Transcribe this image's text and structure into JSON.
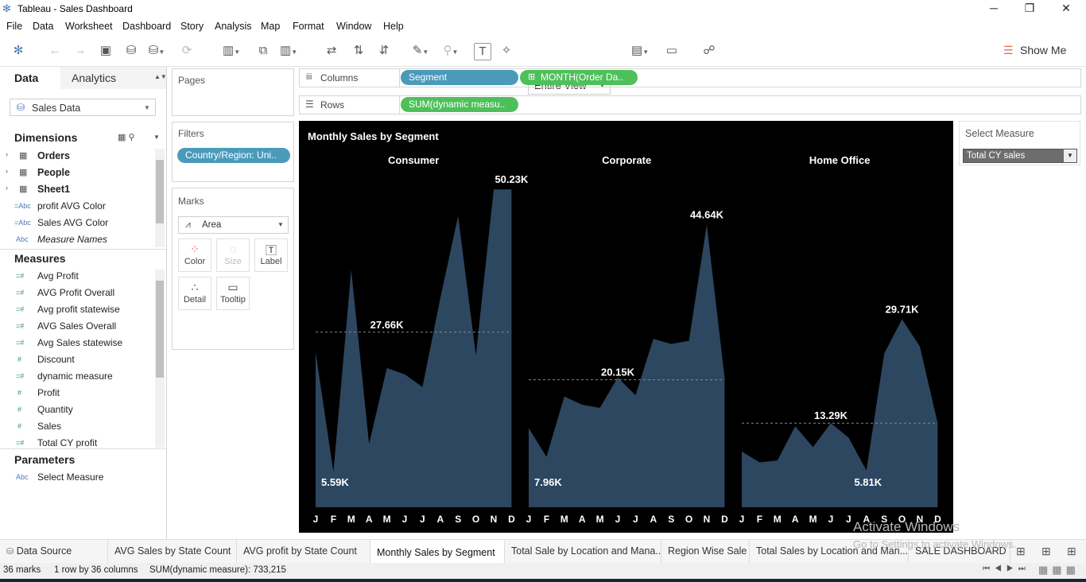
{
  "window": {
    "title": "Tableau - Sales Dashboard",
    "min": "─",
    "max": "❐",
    "close": "✕"
  },
  "menu": [
    "File",
    "Data",
    "Worksheet",
    "Dashboard",
    "Story",
    "Analysis",
    "Map",
    "Format",
    "Window",
    "Help"
  ],
  "toolbar": {
    "view_fit": "Entire View",
    "show_me": "Show Me"
  },
  "left": {
    "tabs": {
      "data": "Data",
      "analytics": "Analytics"
    },
    "datasource": "Sales Data",
    "dimensions_title": "Dimensions",
    "dimensions": [
      {
        "label": "Orders",
        "bold": true,
        "icon": "table-icon"
      },
      {
        "label": "People",
        "bold": true,
        "icon": "table-icon"
      },
      {
        "label": "Sheet1",
        "bold": true,
        "icon": "table-icon"
      },
      {
        "label": "profit AVG Color",
        "icon": "calc-string-icon",
        "prefix": "=Abc"
      },
      {
        "label": "Sales AVG Color",
        "icon": "calc-string-icon",
        "prefix": "=Abc"
      },
      {
        "label": "Measure Names",
        "italic": true,
        "icon": "string-icon",
        "prefix": "Abc"
      }
    ],
    "measures_title": "Measures",
    "measures": [
      {
        "label": "Avg Profit",
        "prefix": "=#"
      },
      {
        "label": "AVG Profit Overall",
        "prefix": "=#"
      },
      {
        "label": "Avg profit statewise",
        "prefix": "=#"
      },
      {
        "label": "AVG Sales Overall",
        "prefix": "=#"
      },
      {
        "label": "Avg Sales statewise",
        "prefix": "=#"
      },
      {
        "label": "Discount",
        "prefix": "#"
      },
      {
        "label": "dynamic measure",
        "prefix": "=#"
      },
      {
        "label": "Profit",
        "prefix": "#"
      },
      {
        "label": "Quantity",
        "prefix": "#"
      },
      {
        "label": "Sales",
        "prefix": "#"
      },
      {
        "label": "Total CY profit",
        "prefix": "=#"
      }
    ],
    "parameters_title": "Parameters",
    "parameters": [
      {
        "label": "Select Measure",
        "prefix": "Abc"
      }
    ]
  },
  "cards": {
    "pages": "Pages",
    "filters": "Filters",
    "filter_pill": "Country/Region: Uni..",
    "marks": "Marks",
    "mark_type": "Area",
    "mark_buttons": [
      "Color",
      "Size",
      "Label",
      "Detail",
      "Tooltip"
    ]
  },
  "shelves": {
    "columns_label": "Columns",
    "rows_label": "Rows",
    "columns": [
      "Segment",
      "MONTH(Order Da.."
    ],
    "rows": [
      "SUM(dynamic measu.."
    ]
  },
  "param_card": {
    "title": "Select Measure",
    "value": "Total CY sales"
  },
  "chart_data": {
    "type": "area",
    "title": "Monthly Sales by Segment",
    "colors": {
      "area": "#2d4760",
      "background": "#000000",
      "text": "#ffffff",
      "avg_line": "#7a8a99"
    },
    "x": [
      "J",
      "F",
      "M",
      "A",
      "M",
      "J",
      "J",
      "A",
      "S",
      "O",
      "N",
      "D"
    ],
    "panels": [
      {
        "name": "Consumer",
        "values": [
          24500,
          5590,
          37500,
          10000,
          22000,
          21000,
          19000,
          33000,
          46000,
          24000,
          50200,
          50230
        ],
        "avg": 27660,
        "labels": [
          {
            "text": "5.59K",
            "index": 1,
            "kind": "min"
          },
          {
            "text": "27.66K",
            "index": 4,
            "kind": "avg"
          },
          {
            "text": "50.23K",
            "index": 11,
            "kind": "max"
          }
        ]
      },
      {
        "name": "Corporate",
        "values": [
          12500,
          7960,
          17500,
          16200,
          15700,
          20500,
          17700,
          26600,
          25800,
          26300,
          44640,
          20500
        ],
        "avg": 20150,
        "labels": [
          {
            "text": "7.96K",
            "index": 1,
            "kind": "min"
          },
          {
            "text": "20.15K",
            "index": 5,
            "kind": "avg"
          },
          {
            "text": "44.64K",
            "index": 10,
            "kind": "max"
          }
        ]
      },
      {
        "name": "Home Office",
        "values": [
          8800,
          7100,
          7400,
          12800,
          9500,
          13290,
          11000,
          5810,
          24300,
          29710,
          25400,
          13300
        ],
        "avg": 13290,
        "labels": [
          {
            "text": "13.29K",
            "index": 5,
            "kind": "avg"
          },
          {
            "text": "5.81K",
            "index": 7,
            "kind": "min"
          },
          {
            "text": "29.71K",
            "index": 9,
            "kind": "max"
          }
        ]
      }
    ],
    "ylim": [
      0,
      51000
    ],
    "grid": false,
    "legend": "none"
  },
  "sheet_tabs": [
    "Data Source",
    "AVG Sales by State Count",
    "AVG profit by State Count",
    "Monthly Sales by Segment",
    "Total Sale by Location and Mana...",
    "Region Wise Sale",
    "Total Sales by Location and Man...",
    "SALE DASHBOARD"
  ],
  "active_tab": "Monthly Sales by Segment",
  "status": {
    "marks": "36 marks",
    "dims": "1 row by 36 columns",
    "sum": "SUM(dynamic measure): 733,215"
  },
  "watermark": {
    "line1": "Activate Windows",
    "line2": "Go to Settings to activate Windows."
  }
}
